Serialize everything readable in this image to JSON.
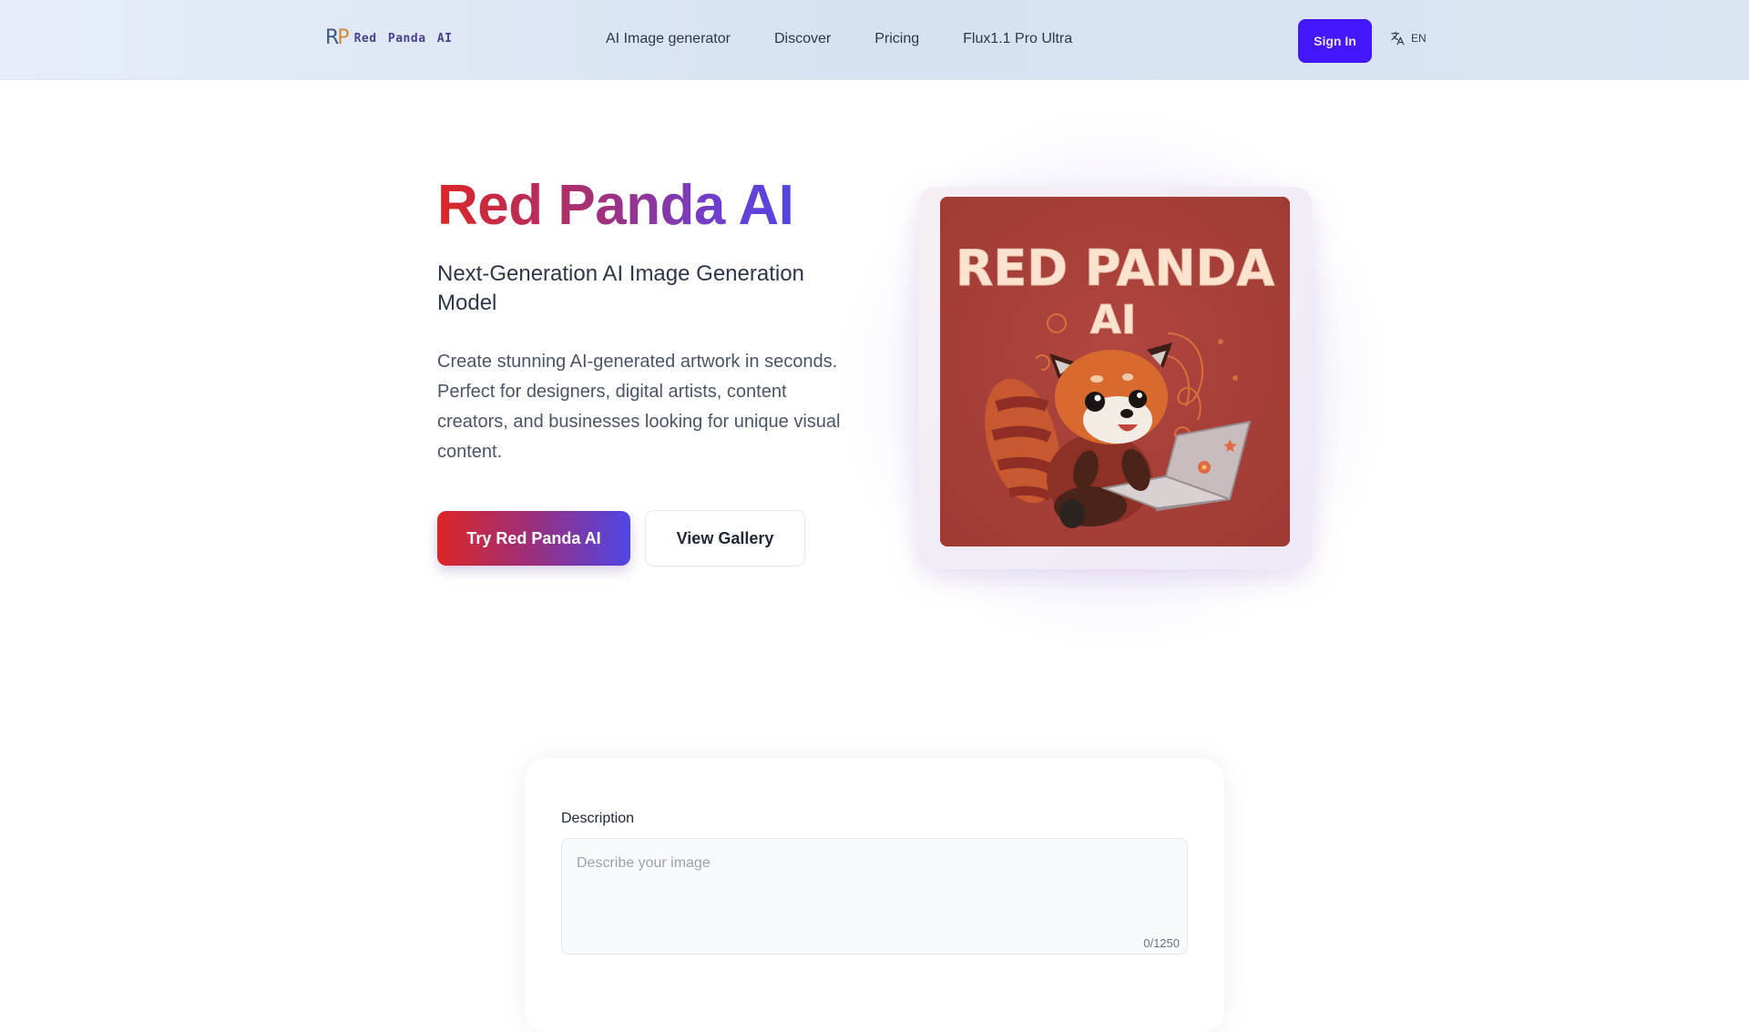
{
  "nav": {
    "logo_mark_r": "R",
    "logo_mark_p": "P",
    "brand": "Red Panda AI",
    "links": [
      {
        "label": "AI Image generator"
      },
      {
        "label": "Discover"
      },
      {
        "label": "Pricing"
      },
      {
        "label": "Flux1.1 Pro Ultra"
      }
    ],
    "signin_label": "Sign In",
    "language": "EN",
    "language_icon": "translate-icon"
  },
  "hero": {
    "title": "Red Panda AI",
    "subtitle": "Next-Generation AI Image Generation Model",
    "description": "Create stunning AI-generated artwork in seconds. Perfect for designers, digital artists, content creators, and businesses looking for unique visual content.",
    "primary_button": "Try Red Panda AI",
    "secondary_button": "View Gallery",
    "image_text_line1": "RED PANDA",
    "image_text_line2": "AI",
    "image_alt": "Red panda illustration using a laptop"
  },
  "form": {
    "description_label": "Description",
    "description_placeholder": "Describe your image",
    "description_value": "",
    "char_count": "0/1250"
  },
  "colors": {
    "accent": "#4318ff",
    "gradient_start": "#dc2626",
    "gradient_end": "#4f46e5"
  }
}
